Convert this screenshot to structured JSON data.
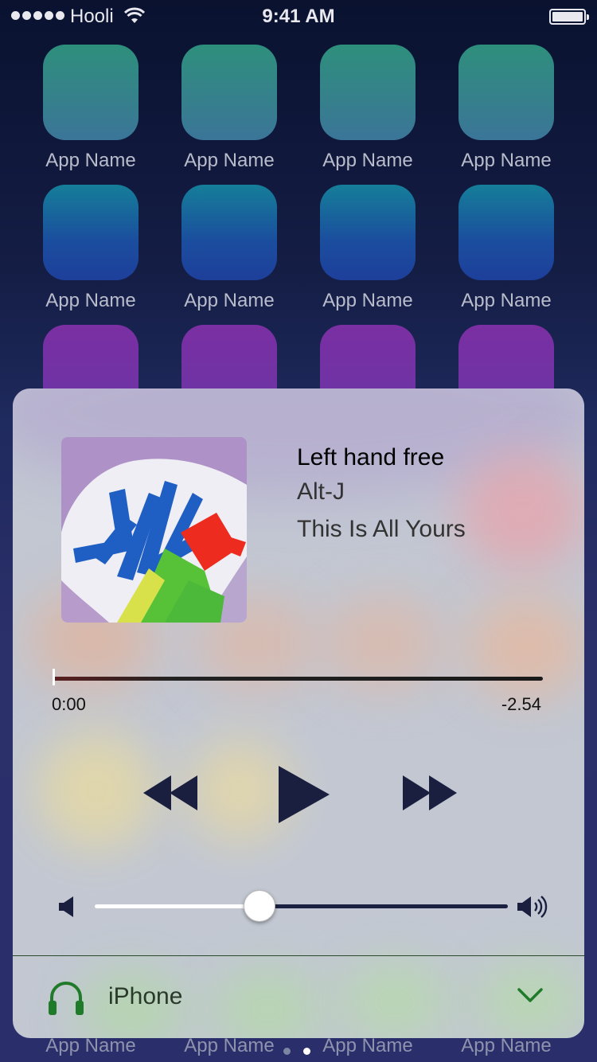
{
  "status_bar": {
    "carrier": "Hooli",
    "time": "9:41 AM"
  },
  "home_screen": {
    "app_label": "App Name",
    "dock_labels": [
      "App Name",
      "App Name",
      "App Name",
      "App Name"
    ]
  },
  "now_playing": {
    "title": "Left hand free",
    "artist": "Alt-J",
    "album": "This Is All Yours",
    "elapsed": "0:00",
    "remaining": "-2.54",
    "progress": 0.0,
    "volume": 0.4
  },
  "audio_route": {
    "label": "iPhone"
  },
  "colors": {
    "control_icon": "#1b1f3f",
    "route_accent": "#1f7a2a"
  },
  "icons": [
    "wifi-icon",
    "battery-icon",
    "rewind-icon",
    "play-icon",
    "fast-forward-icon",
    "volume-low-icon",
    "volume-high-icon",
    "headphones-icon",
    "chevron-down-icon"
  ]
}
